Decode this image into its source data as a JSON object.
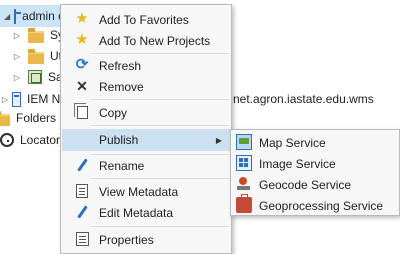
{
  "tree": {
    "admin_label": "admin c",
    "systems_label": "Syste",
    "utilities_label": "Utilit",
    "samples_label": "Samp",
    "iem_label": "IEM NW",
    "iem_url_tail": "net.agron.iastate.edu.wms",
    "folders_label": "Folders",
    "locators_label": "Locators"
  },
  "menu": {
    "add_favorites": "Add To Favorites",
    "add_new_projects": "Add To New Projects",
    "refresh": "Refresh",
    "remove": "Remove",
    "copy": "Copy",
    "publish": "Publish",
    "rename": "Rename",
    "view_metadata": "View Metadata",
    "edit_metadata": "Edit Metadata",
    "properties": "Properties"
  },
  "submenu": {
    "map_service": "Map Service",
    "image_service": "Image Service",
    "geocode_service": "Geocode Service",
    "geoprocessing_service": "Geoprocessing Service"
  },
  "colors": {
    "selection": "#cce4f7",
    "menu_hover": "#cde0f2",
    "menu_bg": "#f7f7f7"
  }
}
